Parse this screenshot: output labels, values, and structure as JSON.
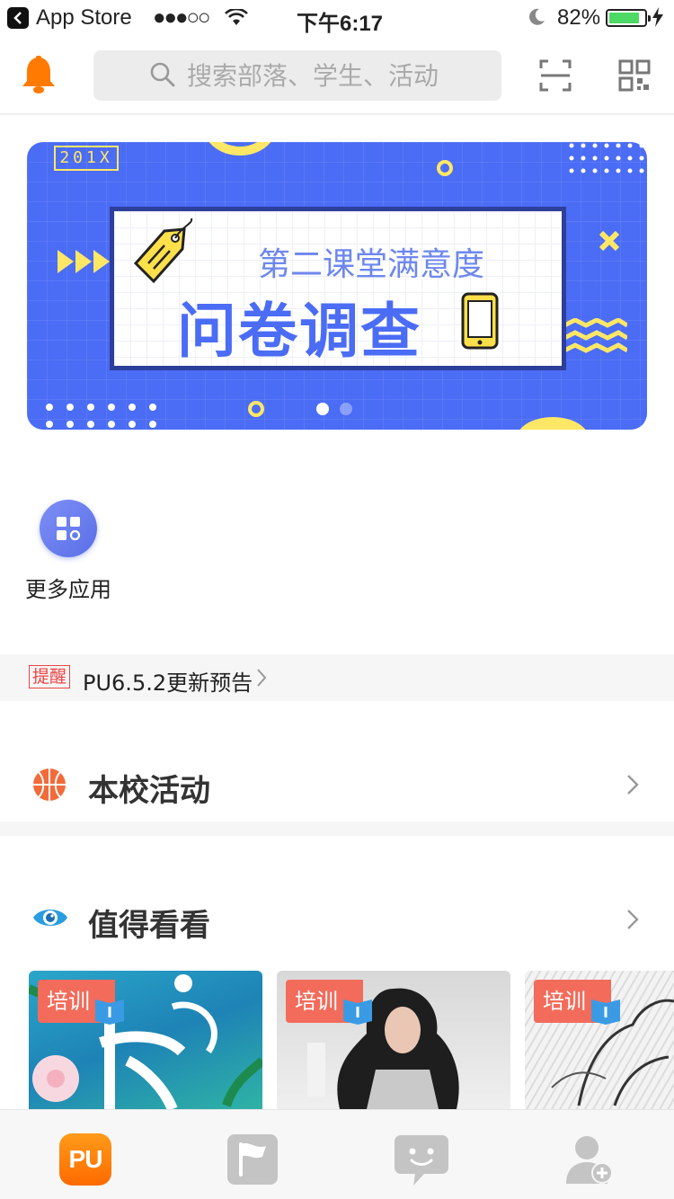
{
  "status_bar": {
    "carrier": "App Store",
    "signal": "●●●○○",
    "time": "下午6:17",
    "battery": "82%",
    "battery_level": 0.82
  },
  "header": {
    "search_placeholder": "搜索部落、学生、活动"
  },
  "banner": {
    "year_tag": "201X",
    "subtitle": "第二课堂满意度",
    "title": "问卷调查",
    "page_count": 2,
    "active_page": 1
  },
  "apps": [
    {
      "label": "更多应用",
      "icon": "grid-apps-icon"
    }
  ],
  "notice": {
    "tag": "提醒",
    "text": "PU6.5.2更新预告"
  },
  "sections": {
    "school_activities": {
      "title": "本校活动",
      "icon": "basketball-icon"
    },
    "worth_watching": {
      "title": "值得看看",
      "icon": "eye-icon"
    }
  },
  "cards": [
    {
      "tag": "培训"
    },
    {
      "tag": "培训"
    },
    {
      "tag": "培训"
    }
  ],
  "tabbar": {
    "tabs": [
      {
        "name": "home",
        "label": "PU",
        "icon": "pu-logo-icon",
        "active": true
      },
      {
        "name": "tribe",
        "icon": "flag-icon"
      },
      {
        "name": "messages",
        "icon": "chat-bubble-icon"
      },
      {
        "name": "profile",
        "icon": "user-add-icon"
      }
    ]
  },
  "colors": {
    "accent_orange": "#ff7a00",
    "banner_blue": "#4b6cf5",
    "tag_red": "#f26b5b",
    "notice_red": "#ee4444"
  }
}
